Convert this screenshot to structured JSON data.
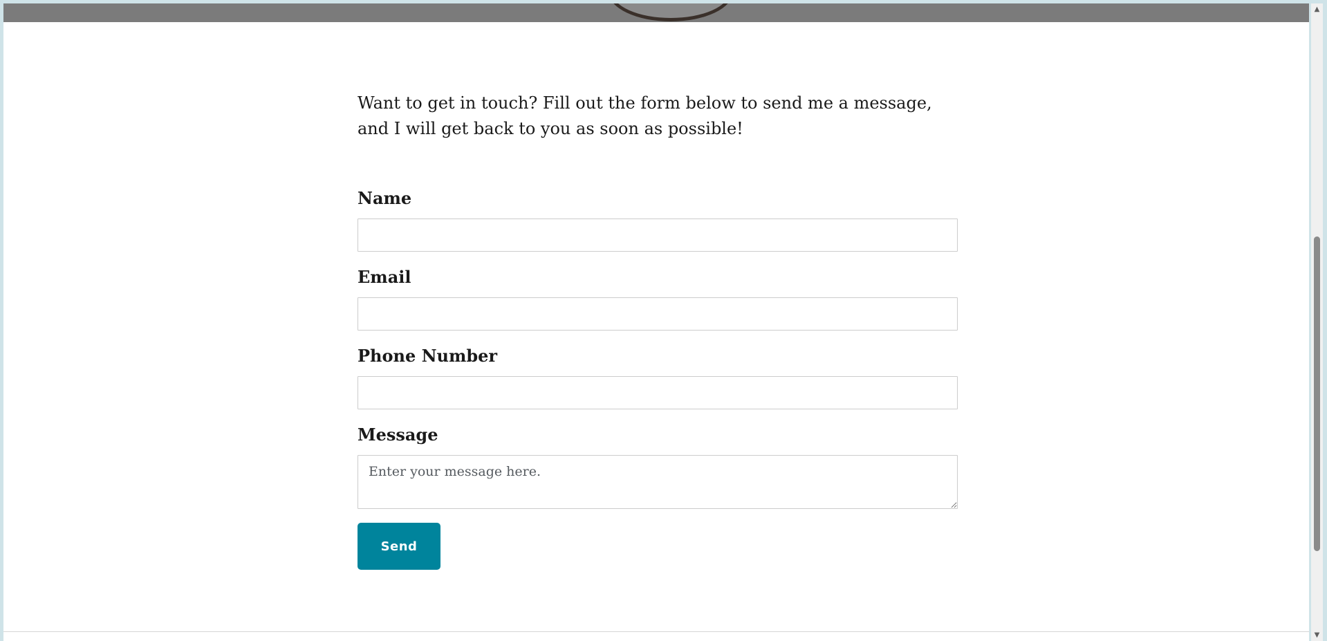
{
  "intro": {
    "text": "Want to get in touch? Fill out the form below to send me a message, and I will get back to you as soon as possible!"
  },
  "form": {
    "name_label": "Name",
    "name_value": "",
    "email_label": "Email",
    "email_value": "",
    "phone_label": "Phone Number",
    "phone_value": "",
    "message_label": "Message",
    "message_placeholder": "Enter your message here.",
    "message_value": "",
    "send_label": "Send"
  },
  "scrollbar": {
    "up_icon": "▲",
    "down_icon": "▼"
  },
  "colors": {
    "accent": "#00849c",
    "hero_strip": "#7b7b7b",
    "outer_background": "#cfe3e8"
  }
}
